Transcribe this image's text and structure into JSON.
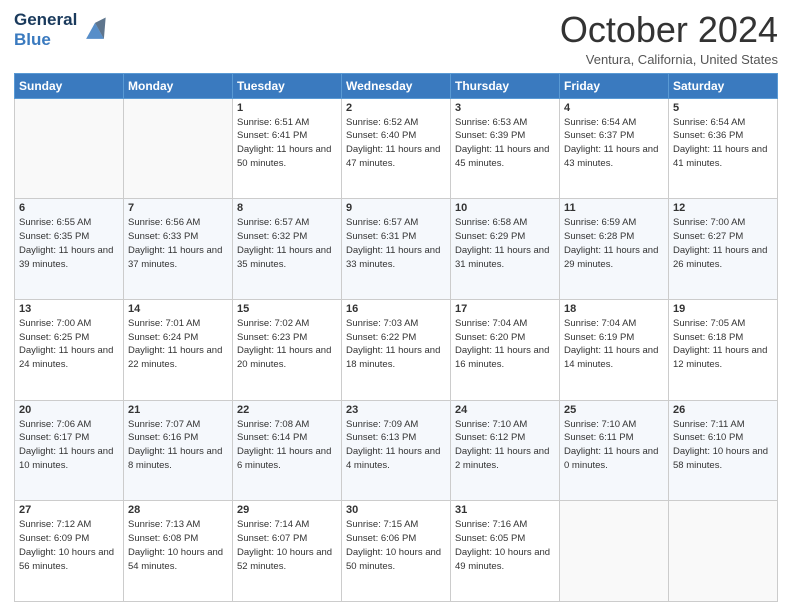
{
  "logo": {
    "line1": "General",
    "line2": "Blue"
  },
  "title": "October 2024",
  "location": "Ventura, California, United States",
  "headers": [
    "Sunday",
    "Monday",
    "Tuesday",
    "Wednesday",
    "Thursday",
    "Friday",
    "Saturday"
  ],
  "weeks": [
    [
      {
        "day": "",
        "sunrise": "",
        "sunset": "",
        "daylight": ""
      },
      {
        "day": "",
        "sunrise": "",
        "sunset": "",
        "daylight": ""
      },
      {
        "day": "1",
        "sunrise": "Sunrise: 6:51 AM",
        "sunset": "Sunset: 6:41 PM",
        "daylight": "Daylight: 11 hours and 50 minutes."
      },
      {
        "day": "2",
        "sunrise": "Sunrise: 6:52 AM",
        "sunset": "Sunset: 6:40 PM",
        "daylight": "Daylight: 11 hours and 47 minutes."
      },
      {
        "day": "3",
        "sunrise": "Sunrise: 6:53 AM",
        "sunset": "Sunset: 6:39 PM",
        "daylight": "Daylight: 11 hours and 45 minutes."
      },
      {
        "day": "4",
        "sunrise": "Sunrise: 6:54 AM",
        "sunset": "Sunset: 6:37 PM",
        "daylight": "Daylight: 11 hours and 43 minutes."
      },
      {
        "day": "5",
        "sunrise": "Sunrise: 6:54 AM",
        "sunset": "Sunset: 6:36 PM",
        "daylight": "Daylight: 11 hours and 41 minutes."
      }
    ],
    [
      {
        "day": "6",
        "sunrise": "Sunrise: 6:55 AM",
        "sunset": "Sunset: 6:35 PM",
        "daylight": "Daylight: 11 hours and 39 minutes."
      },
      {
        "day": "7",
        "sunrise": "Sunrise: 6:56 AM",
        "sunset": "Sunset: 6:33 PM",
        "daylight": "Daylight: 11 hours and 37 minutes."
      },
      {
        "day": "8",
        "sunrise": "Sunrise: 6:57 AM",
        "sunset": "Sunset: 6:32 PM",
        "daylight": "Daylight: 11 hours and 35 minutes."
      },
      {
        "day": "9",
        "sunrise": "Sunrise: 6:57 AM",
        "sunset": "Sunset: 6:31 PM",
        "daylight": "Daylight: 11 hours and 33 minutes."
      },
      {
        "day": "10",
        "sunrise": "Sunrise: 6:58 AM",
        "sunset": "Sunset: 6:29 PM",
        "daylight": "Daylight: 11 hours and 31 minutes."
      },
      {
        "day": "11",
        "sunrise": "Sunrise: 6:59 AM",
        "sunset": "Sunset: 6:28 PM",
        "daylight": "Daylight: 11 hours and 29 minutes."
      },
      {
        "day": "12",
        "sunrise": "Sunrise: 7:00 AM",
        "sunset": "Sunset: 6:27 PM",
        "daylight": "Daylight: 11 hours and 26 minutes."
      }
    ],
    [
      {
        "day": "13",
        "sunrise": "Sunrise: 7:00 AM",
        "sunset": "Sunset: 6:25 PM",
        "daylight": "Daylight: 11 hours and 24 minutes."
      },
      {
        "day": "14",
        "sunrise": "Sunrise: 7:01 AM",
        "sunset": "Sunset: 6:24 PM",
        "daylight": "Daylight: 11 hours and 22 minutes."
      },
      {
        "day": "15",
        "sunrise": "Sunrise: 7:02 AM",
        "sunset": "Sunset: 6:23 PM",
        "daylight": "Daylight: 11 hours and 20 minutes."
      },
      {
        "day": "16",
        "sunrise": "Sunrise: 7:03 AM",
        "sunset": "Sunset: 6:22 PM",
        "daylight": "Daylight: 11 hours and 18 minutes."
      },
      {
        "day": "17",
        "sunrise": "Sunrise: 7:04 AM",
        "sunset": "Sunset: 6:20 PM",
        "daylight": "Daylight: 11 hours and 16 minutes."
      },
      {
        "day": "18",
        "sunrise": "Sunrise: 7:04 AM",
        "sunset": "Sunset: 6:19 PM",
        "daylight": "Daylight: 11 hours and 14 minutes."
      },
      {
        "day": "19",
        "sunrise": "Sunrise: 7:05 AM",
        "sunset": "Sunset: 6:18 PM",
        "daylight": "Daylight: 11 hours and 12 minutes."
      }
    ],
    [
      {
        "day": "20",
        "sunrise": "Sunrise: 7:06 AM",
        "sunset": "Sunset: 6:17 PM",
        "daylight": "Daylight: 11 hours and 10 minutes."
      },
      {
        "day": "21",
        "sunrise": "Sunrise: 7:07 AM",
        "sunset": "Sunset: 6:16 PM",
        "daylight": "Daylight: 11 hours and 8 minutes."
      },
      {
        "day": "22",
        "sunrise": "Sunrise: 7:08 AM",
        "sunset": "Sunset: 6:14 PM",
        "daylight": "Daylight: 11 hours and 6 minutes."
      },
      {
        "day": "23",
        "sunrise": "Sunrise: 7:09 AM",
        "sunset": "Sunset: 6:13 PM",
        "daylight": "Daylight: 11 hours and 4 minutes."
      },
      {
        "day": "24",
        "sunrise": "Sunrise: 7:10 AM",
        "sunset": "Sunset: 6:12 PM",
        "daylight": "Daylight: 11 hours and 2 minutes."
      },
      {
        "day": "25",
        "sunrise": "Sunrise: 7:10 AM",
        "sunset": "Sunset: 6:11 PM",
        "daylight": "Daylight: 11 hours and 0 minutes."
      },
      {
        "day": "26",
        "sunrise": "Sunrise: 7:11 AM",
        "sunset": "Sunset: 6:10 PM",
        "daylight": "Daylight: 10 hours and 58 minutes."
      }
    ],
    [
      {
        "day": "27",
        "sunrise": "Sunrise: 7:12 AM",
        "sunset": "Sunset: 6:09 PM",
        "daylight": "Daylight: 10 hours and 56 minutes."
      },
      {
        "day": "28",
        "sunrise": "Sunrise: 7:13 AM",
        "sunset": "Sunset: 6:08 PM",
        "daylight": "Daylight: 10 hours and 54 minutes."
      },
      {
        "day": "29",
        "sunrise": "Sunrise: 7:14 AM",
        "sunset": "Sunset: 6:07 PM",
        "daylight": "Daylight: 10 hours and 52 minutes."
      },
      {
        "day": "30",
        "sunrise": "Sunrise: 7:15 AM",
        "sunset": "Sunset: 6:06 PM",
        "daylight": "Daylight: 10 hours and 50 minutes."
      },
      {
        "day": "31",
        "sunrise": "Sunrise: 7:16 AM",
        "sunset": "Sunset: 6:05 PM",
        "daylight": "Daylight: 10 hours and 49 minutes."
      },
      {
        "day": "",
        "sunrise": "",
        "sunset": "",
        "daylight": ""
      },
      {
        "day": "",
        "sunrise": "",
        "sunset": "",
        "daylight": ""
      }
    ]
  ]
}
